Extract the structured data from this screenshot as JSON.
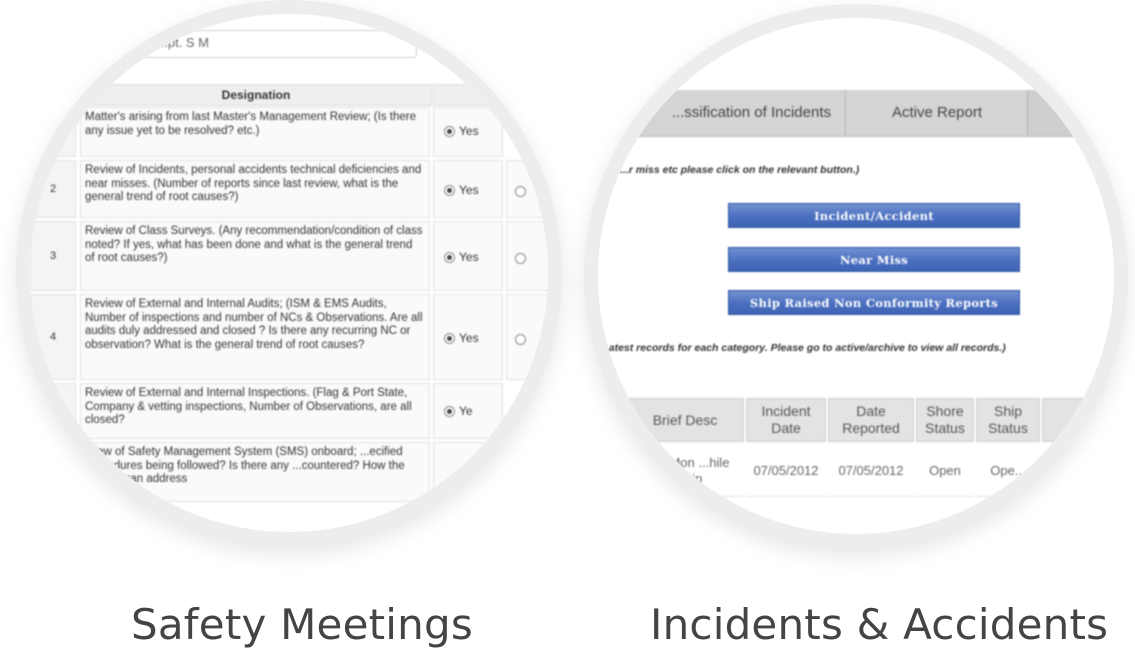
{
  "captions": {
    "left": "Safety Meetings",
    "right": "Incidents & Accidents"
  },
  "meeting": {
    "name_value": "...pt. S M",
    "designation_header": "Designation",
    "rows": [
      {
        "num": "",
        "text": "Matter's arising from last Master's Management Review; (Is there any issue yet to be resolved? etc.)",
        "answer": "Yes"
      },
      {
        "num": "2",
        "text": "Review of Incidents, personal accidents technical deficiencies and near misses. (Number of reports since last review, what is the general trend of root causes?)",
        "answer": "Yes"
      },
      {
        "num": "3",
        "text": "Review of Class Surveys. (Any recommendation/condition of class noted? If yes, what has been done and what is the general trend of root causes?)",
        "answer": "Yes"
      },
      {
        "num": "4",
        "text": "Review of External and Internal Audits; (ISM & EMS Audits, Number of inspections and number of NCs & Observations. Are all audits duly addressed and closed ? Is there any recurring NC or observation? What is the general trend of root causes?",
        "answer": "Yes"
      },
      {
        "num": "",
        "text": "Review of External and Internal Inspections. (Flag & Port State, Company & vetting inspections, Number of Observations, are all closed?",
        "answer": "Ye"
      },
      {
        "num": "",
        "text": "...iew of Safety Management System (SMS) onboard; ...ecified procedures being followed? Is there any ...countered? How the system can address",
        "answer": ""
      }
    ]
  },
  "incidents": {
    "tabs": [
      "...ssification of Incidents",
      "Active Report",
      ""
    ],
    "note_top": "...r miss etc please click on the relevant button.)",
    "buttons": [
      "Incident/Accident",
      "Near Miss",
      "Ship Raised Non Conformity Reports"
    ],
    "note_bottom": "...atest records for each category. Please go to active/archive to view all records.)",
    "table": {
      "headers": [
        "Brief Desc",
        "Incident Date",
        "Date Reported",
        "Shore Status",
        "Ship Status"
      ],
      "row": [
        "...an Mon ...hile ...ship",
        "07/05/2012",
        "07/05/2012",
        "Open",
        "Ope..."
      ]
    }
  }
}
